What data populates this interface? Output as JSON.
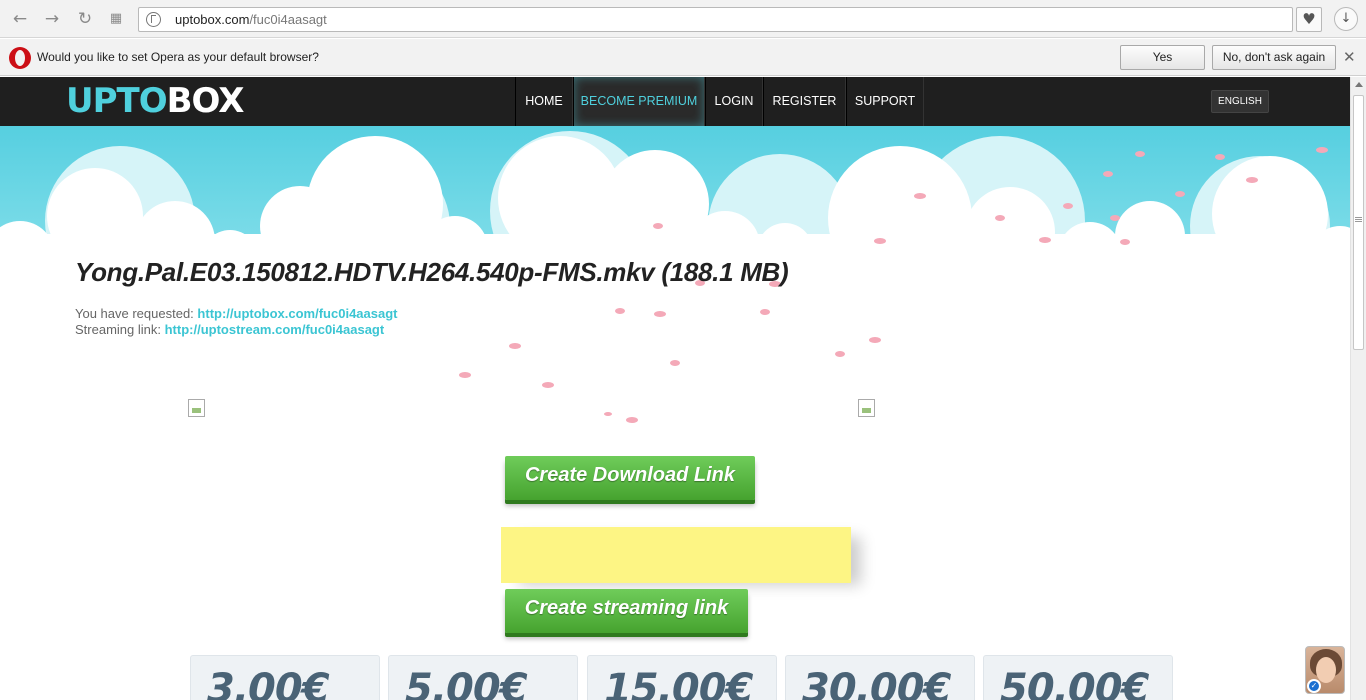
{
  "browser": {
    "url_domain": "uptobox.com",
    "url_path": "/fuc0i4aasagt",
    "infobar": {
      "message": "Would you like to set Opera as your default browser?",
      "yes_label": "Yes",
      "no_label": "No, don't ask again",
      "close_glyph": "✕"
    },
    "icons": [
      "back-icon",
      "forward-icon",
      "reload-icon",
      "speed-dial-icon",
      "site-info-icon",
      "heart-icon",
      "download-icon"
    ]
  },
  "site": {
    "logo_part1": "UPTO",
    "logo_part2": "BOX",
    "nav": {
      "home": "HOME",
      "premium": "BECOME PREMIUM",
      "login": "LOGIN",
      "register": "REGISTER",
      "support": "SUPPORT"
    },
    "language": "ENGLISH",
    "accent_color": "#4fd0dd"
  },
  "file": {
    "title": "Yong.Pal.E03.150812.HDTV.H264.540p-FMS.mkv (188.1 MB)",
    "requested_label": "You have requested:",
    "requested_url": "http://uptobox.com/fuc0i4aasagt",
    "streaming_label": "Streaming link:",
    "streaming_url": "http://uptostream.com/fuc0i4aasagt"
  },
  "actions": {
    "download_label": "Create Download Link",
    "streaming_label": "Create streaming link"
  },
  "prices": [
    "3.00€",
    "5.00€",
    "15.00€",
    "30.00€",
    "50.00€"
  ]
}
